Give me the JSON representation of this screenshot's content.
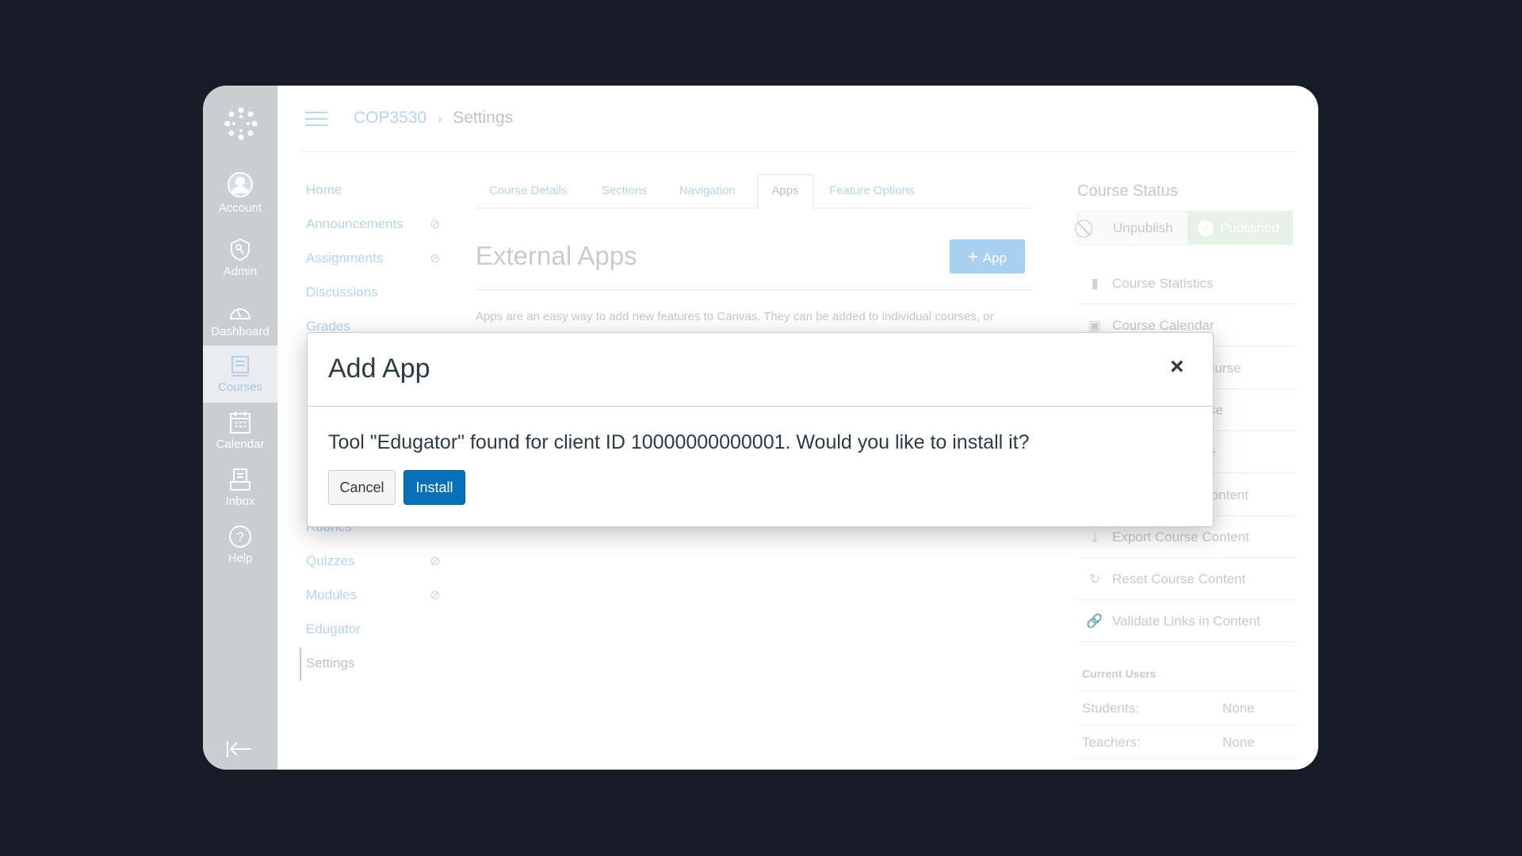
{
  "sidebar": {
    "items": [
      {
        "label": "Account",
        "icon": "account-icon"
      },
      {
        "label": "Admin",
        "icon": "admin-shield-icon"
      },
      {
        "label": "Dashboard",
        "icon": "dashboard-icon"
      },
      {
        "label": "Courses",
        "icon": "courses-icon",
        "active": true
      },
      {
        "label": "Calendar",
        "icon": "calendar-icon"
      },
      {
        "label": "Inbox",
        "icon": "inbox-icon"
      },
      {
        "label": "Help",
        "icon": "help-icon"
      }
    ]
  },
  "breadcrumb": {
    "course": "COP3530",
    "sep": "›",
    "page": "Settings"
  },
  "course_nav": [
    {
      "label": "Home"
    },
    {
      "label": "Announcements",
      "hidden": true
    },
    {
      "label": "Assignments",
      "hidden": true
    },
    {
      "label": "Discussions"
    },
    {
      "label": "Grades"
    },
    {
      "label": "Rubrics"
    },
    {
      "label": "Quizzes",
      "hidden": true
    },
    {
      "label": "Modules",
      "hidden": true
    },
    {
      "label": "Edugator"
    },
    {
      "label": "Settings",
      "active": true
    }
  ],
  "tabs": [
    "Course Details",
    "Sections",
    "Navigation",
    "Apps",
    "Feature Options"
  ],
  "active_tab": "Apps",
  "main": {
    "heading": "External Apps",
    "add_app": "App",
    "description": "Apps are an easy way to add new features to Canvas. They can be added to individual courses, or"
  },
  "course_status": {
    "title": "Course Status",
    "unpublish": "Unpublish",
    "published": "Published"
  },
  "right_links": [
    {
      "label": "Course Statistics",
      "icon": "bar-chart-icon"
    },
    {
      "label": "Course Calendar",
      "icon": "calendar-icon"
    },
    {
      "label": "Conclude this Course",
      "icon": "conclude-icon"
    },
    {
      "label": "Delete this Course",
      "icon": "trash-icon"
    },
    {
      "label": "Copy this Course",
      "icon": "copy-icon"
    },
    {
      "label": "Import Course Content",
      "icon": "import-icon"
    },
    {
      "label": "Export Course Content",
      "icon": "download-icon"
    },
    {
      "label": "Reset Course Content",
      "icon": "reset-icon"
    },
    {
      "label": "Validate Links in Content",
      "icon": "link-icon"
    }
  ],
  "current_users": {
    "title": "Current Users",
    "rows": [
      {
        "label": "Students:",
        "value": "None"
      },
      {
        "label": "Teachers:",
        "value": "None"
      }
    ]
  },
  "modal": {
    "title": "Add App",
    "close": "×",
    "message": "Tool \"Edugator\" found for client ID 10000000000001. Would you like to install it?",
    "cancel": "Cancel",
    "install": "Install"
  },
  "colors": {
    "primary": "#0770b8",
    "background": "#161b26",
    "success": "#e6f2e6"
  }
}
